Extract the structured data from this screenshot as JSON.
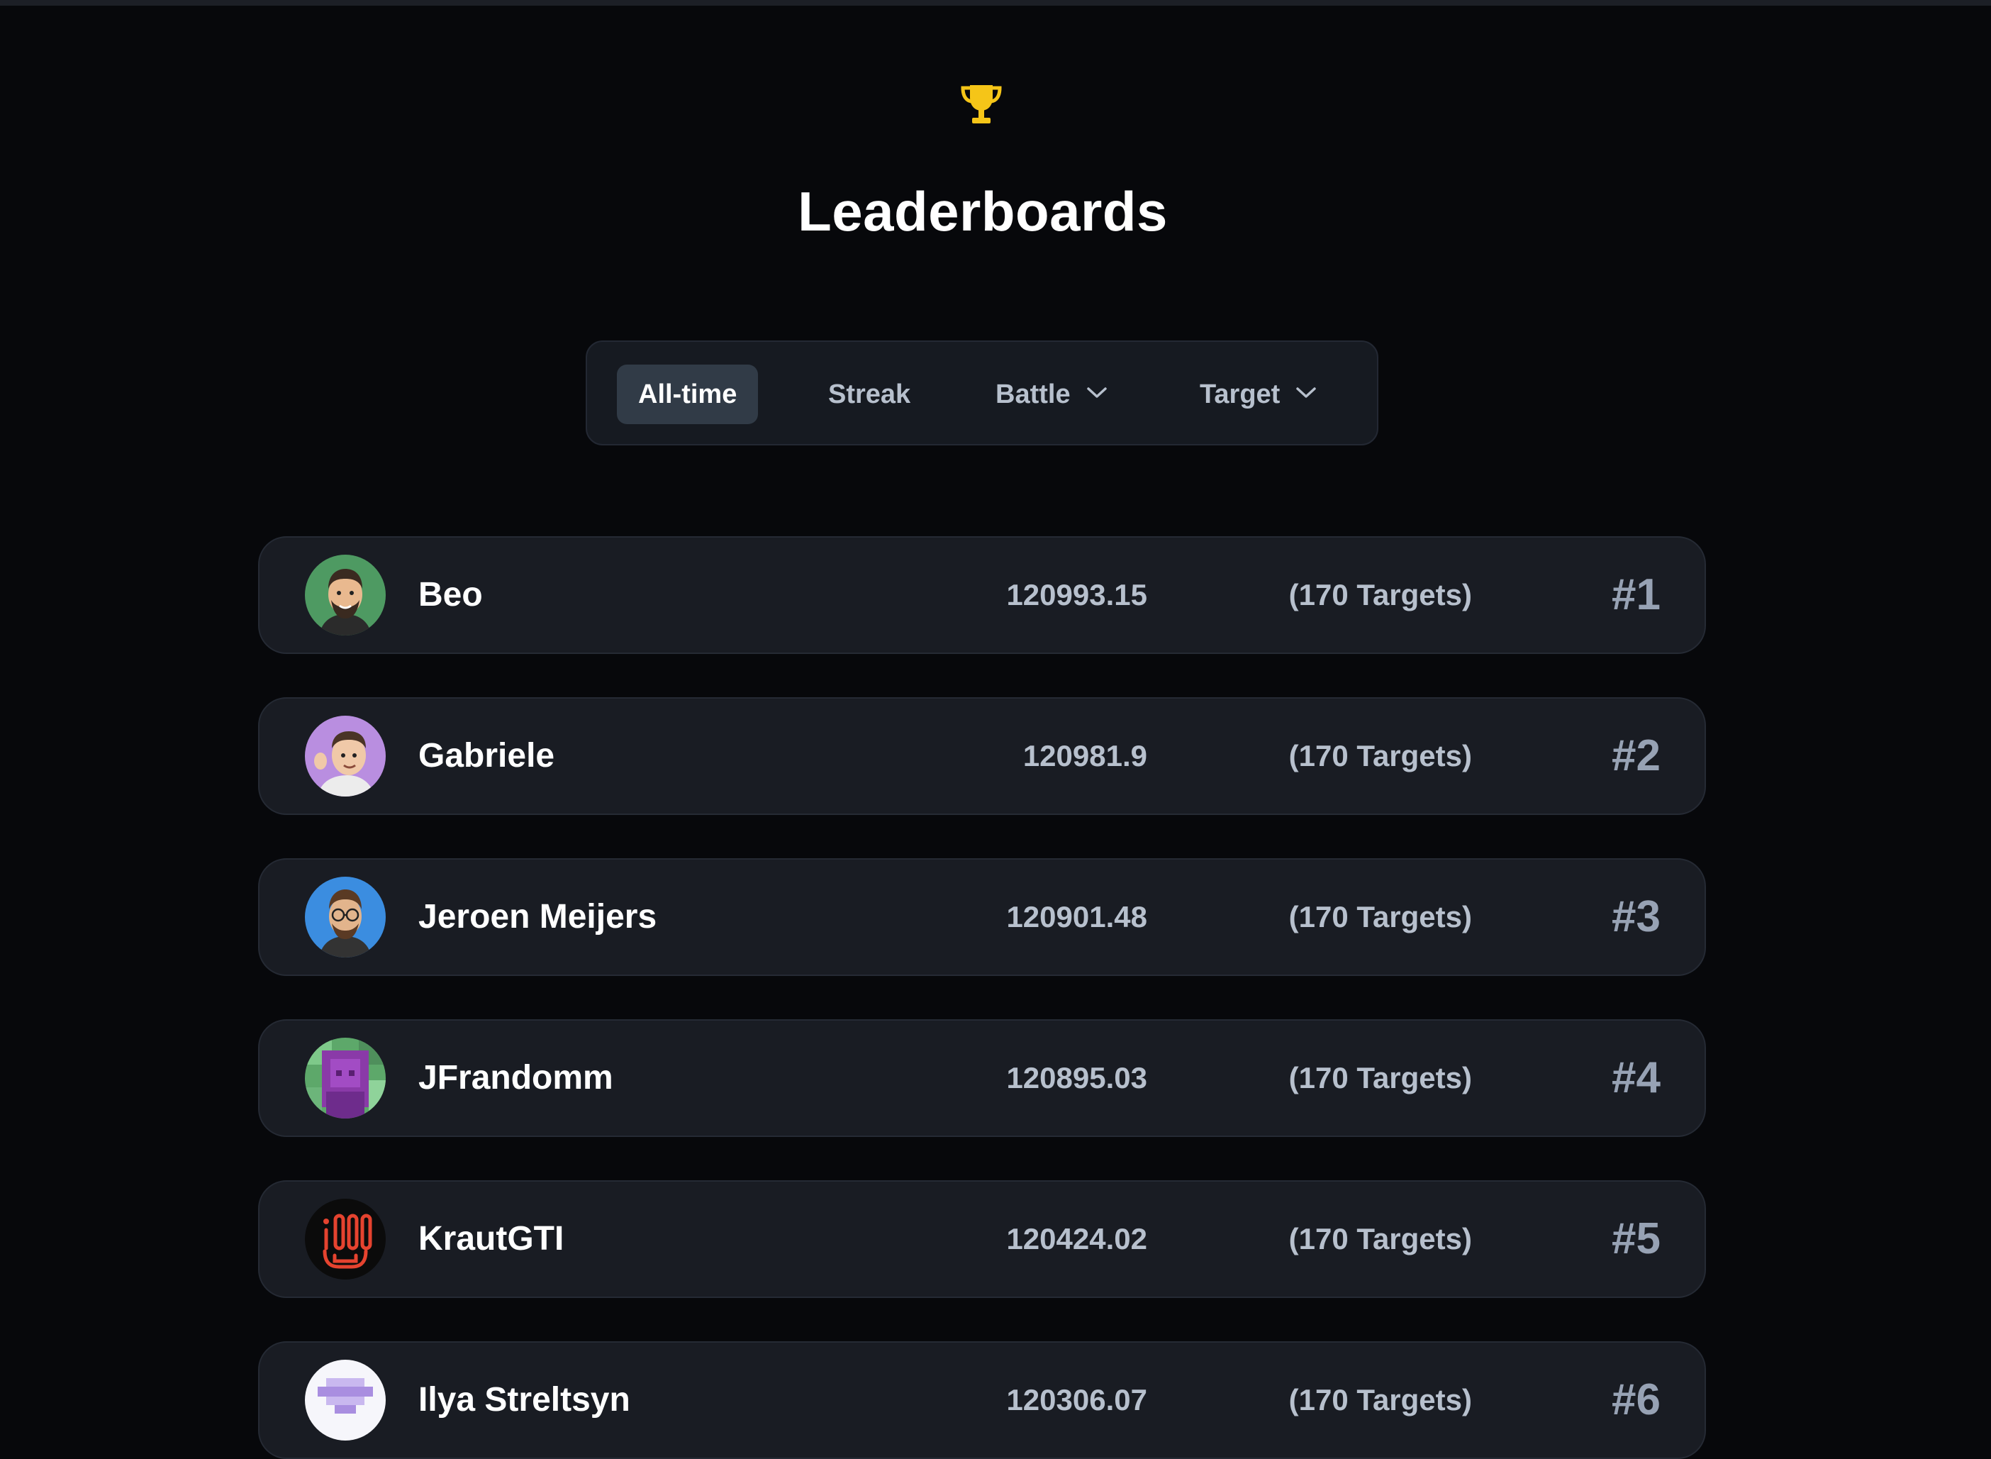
{
  "header": {
    "icon": "trophy-icon",
    "title": "Leaderboards",
    "accent_color": "#f5c518"
  },
  "filters": {
    "tabs": [
      {
        "label": "All-time",
        "active": true
      },
      {
        "label": "Streak",
        "active": false
      },
      {
        "label": "Battle",
        "active": false,
        "dropdown": true
      },
      {
        "label": "Target",
        "active": false,
        "dropdown": true
      }
    ]
  },
  "leaderboard": {
    "rows": [
      {
        "name": "Beo",
        "score": "120993.15",
        "targets": "(170 Targets)",
        "rank": "#1"
      },
      {
        "name": "Gabriele",
        "score": "120981.9",
        "targets": "(170 Targets)",
        "rank": "#2"
      },
      {
        "name": "Jeroen Meijers",
        "score": "120901.48",
        "targets": "(170 Targets)",
        "rank": "#3"
      },
      {
        "name": "JFrandomm",
        "score": "120895.03",
        "targets": "(170 Targets)",
        "rank": "#4"
      },
      {
        "name": "KrautGTI",
        "score": "120424.02",
        "targets": "(170 Targets)",
        "rank": "#5"
      },
      {
        "name": "Ilya Streltsyn",
        "score": "120306.07",
        "targets": "(170 Targets)",
        "rank": "#6"
      }
    ]
  }
}
